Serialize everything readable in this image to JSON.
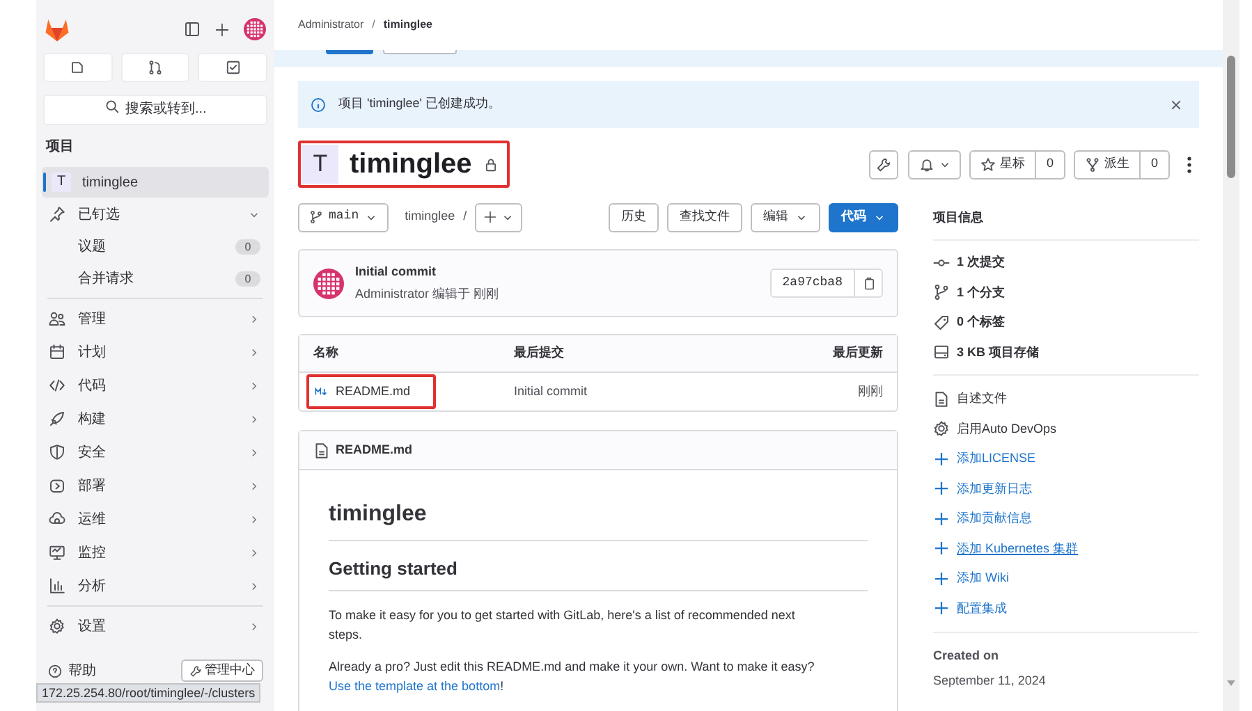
{
  "sidebar": {
    "search": {
      "placeholder": "搜索或转到..."
    },
    "section_title": "项目",
    "project": {
      "avatar": "T",
      "name": "timinglee",
      "selected": true
    },
    "pinned": {
      "label": "已钉选",
      "expanded": true,
      "children": [
        {
          "label": "议题",
          "count": "0"
        },
        {
          "label": "合并请求",
          "count": "0"
        }
      ]
    },
    "items": [
      {
        "label": "管理"
      },
      {
        "label": "计划"
      },
      {
        "label": "代码"
      },
      {
        "label": "构建"
      },
      {
        "label": "安全"
      },
      {
        "label": "部署"
      },
      {
        "label": "运维"
      },
      {
        "label": "监控"
      },
      {
        "label": "分析"
      }
    ],
    "settings": {
      "label": "设置"
    },
    "help": "帮助",
    "admin_button": "管理中心"
  },
  "status_url": "172.25.254.80/root/timinglee/-/clusters",
  "breadcrumb": [
    "Administrator",
    "timinglee"
  ],
  "breadcrumb_separator": "/",
  "alert": {
    "text": "项目 'timinglee' 已创建成功。"
  },
  "project": {
    "avatar": "T",
    "title": "timinglee",
    "private": true,
    "annotated": true
  },
  "actions": {
    "star": {
      "label": "星标",
      "count": "0"
    },
    "fork": {
      "label": "派生",
      "count": "0"
    }
  },
  "toolbar": {
    "branch": "main",
    "path": "timinglee",
    "separator": "/",
    "buttons": [
      {
        "label": "历史",
        "primary": false,
        "dropdown": false
      },
      {
        "label": "查找文件",
        "primary": false,
        "dropdown": false
      },
      {
        "label": "编辑",
        "primary": false,
        "dropdown": true
      },
      {
        "label": "代码",
        "primary": true,
        "dropdown": true
      }
    ]
  },
  "commit": {
    "title": "Initial commit",
    "meta": "Administrator 编辑于 刚刚",
    "sha": "2a97cba8"
  },
  "files": {
    "columns": [
      "名称",
      "最后提交",
      "最后更新"
    ],
    "rows": [
      {
        "name": "README.md",
        "commit": "Initial commit",
        "updated": "刚刚",
        "annotated": true
      }
    ]
  },
  "readme": {
    "filename": "README.md",
    "h1": "timinglee",
    "h2": "Getting started",
    "paragraph": "To make it easy for you to get started with GitLab, here's a list of recommended next steps.",
    "paragraph2": "Already a pro? Just edit this README.md and make it your own. Want to make it easy?",
    "link": "Use the template at the bottom",
    "link_suffix": "!"
  },
  "info": {
    "title": "项目信息",
    "stats": [
      {
        "label": "1 次提交"
      },
      {
        "label": "1 个分支"
      },
      {
        "label": "0 个标签"
      },
      {
        "label": "3 KB 项目存储"
      }
    ],
    "links": [
      {
        "kind": "file",
        "label": "自述文件"
      },
      {
        "kind": "gear",
        "label": "启用Auto DevOps"
      },
      {
        "kind": "add",
        "label": "添加LICENSE"
      },
      {
        "kind": "add",
        "label": "添加更新日志"
      },
      {
        "kind": "add",
        "label": "添加贡献信息"
      },
      {
        "kind": "add_underlined",
        "label": "添加 Kubernetes 集群"
      },
      {
        "kind": "add",
        "label": "添加 Wiki"
      },
      {
        "kind": "add",
        "label": "配置集成"
      }
    ],
    "created_label": "Created on",
    "created_date": "September 11, 2024"
  }
}
